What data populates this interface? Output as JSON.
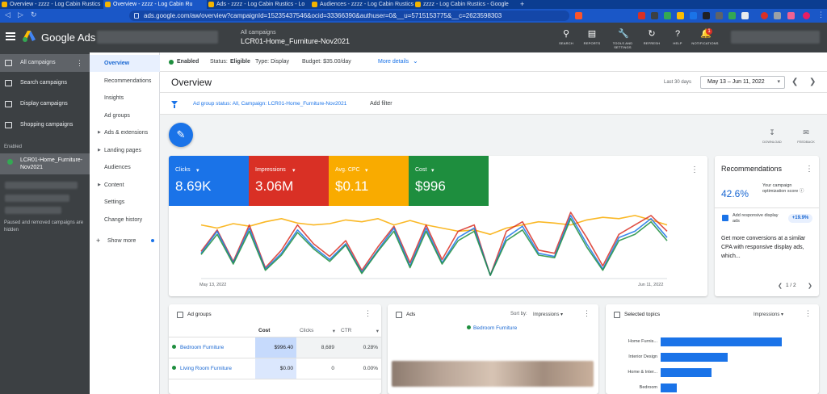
{
  "browser": {
    "tabs": [
      {
        "label": "Overview - zzzz - Log Cabin Rustics"
      },
      {
        "label": "Overview - zzzz - Log Cabin Ru"
      },
      {
        "label": "Ads - zzzz - Log Cabin Rustics - Lo"
      },
      {
        "label": "Audiences - zzzz - Log Cabin Rustics"
      },
      {
        "label": "zzzz - Log Cabin Rustics - Google"
      }
    ],
    "url": "ads.google.com/aw/overview?campaignId=15235437546&ocid=33366390&authuser=0&__u=5715153775&__c=2623598303"
  },
  "header": {
    "product": "Google Ads",
    "crumb": "All campaigns",
    "campaign": "LCR01-Home_Furniture-Nov2021",
    "tools": [
      {
        "label": "SEARCH",
        "icon": "search-icon"
      },
      {
        "label": "REPORTS",
        "icon": "reports-icon"
      },
      {
        "label": "TOOLS AND SETTINGS",
        "icon": "wrench-icon"
      },
      {
        "label": "REFRESH",
        "icon": "refresh-icon"
      },
      {
        "label": "HELP",
        "icon": "help-icon"
      },
      {
        "label": "NOTIFICATIONS",
        "icon": "bell-icon"
      }
    ],
    "notification_count": "1"
  },
  "leftnav": {
    "items": [
      {
        "label": "All campaigns"
      },
      {
        "label": "Search campaigns"
      },
      {
        "label": "Display campaigns"
      },
      {
        "label": "Shopping campaigns"
      }
    ],
    "enabled_heading": "Enabled",
    "campaign": "LCR01-Home_Furniture-Nov2021",
    "note": "Paused and removed campaigns are hidden"
  },
  "pagemenu": {
    "items": [
      {
        "label": "Overview"
      },
      {
        "label": "Recommendations"
      },
      {
        "label": "Insights"
      },
      {
        "label": "Ad groups"
      },
      {
        "label": "Ads & extensions"
      },
      {
        "label": "Landing pages"
      },
      {
        "label": "Audiences"
      },
      {
        "label": "Content"
      },
      {
        "label": "Settings"
      },
      {
        "label": "Change history"
      }
    ],
    "show_more": "Show more"
  },
  "status": {
    "state": "Enabled",
    "status_label": "Status:",
    "status_value": "Eligible",
    "type": "Type: Display",
    "budget": "Budget: $35.00/day",
    "more": "More details"
  },
  "title_row": {
    "title": "Overview",
    "range_label": "Last 30 days",
    "date_range": "May 13 – Jun 11, 2022"
  },
  "filter": {
    "text": "Ad group status: All, Campaign: LCR01-Home_Furniture-Nov2021",
    "add": "Add filter"
  },
  "tiny_tools": {
    "download": "DOWNLOAD",
    "feedback": "FEEDBACK"
  },
  "metrics": [
    {
      "label": "Clicks",
      "value": "8.69K",
      "color": "#1a73e8"
    },
    {
      "label": "Impressions",
      "value": "3.06M",
      "color": "#d93025"
    },
    {
      "label": "Avg. CPC",
      "value": "$0.11",
      "color": "#f9ab00"
    },
    {
      "label": "Cost",
      "value": "$996",
      "color": "#1e8e3e"
    }
  ],
  "chart_data": {
    "type": "line",
    "x_start": "May 13, 2022",
    "x_end": "Jun 11, 2022",
    "series": [
      {
        "name": "Clicks",
        "color": "#1a73e8",
        "values": [
          0.35,
          0.7,
          0.2,
          0.75,
          0.1,
          0.35,
          0.72,
          0.45,
          0.25,
          0.5,
          0.05,
          0.4,
          0.75,
          0.15,
          0.75,
          0.2,
          0.6,
          0.75,
          0.0,
          0.6,
          0.78,
          0.35,
          0.3,
          0.95,
          0.5,
          0.1,
          0.6,
          0.7,
          0.9,
          0.6
        ]
      },
      {
        "name": "Impressions",
        "color": "#d93025",
        "values": [
          0.38,
          0.72,
          0.22,
          0.8,
          0.12,
          0.4,
          0.8,
          0.5,
          0.3,
          0.55,
          0.08,
          0.45,
          0.78,
          0.2,
          0.8,
          0.25,
          0.7,
          0.8,
          0.0,
          0.7,
          0.85,
          0.4,
          0.35,
          1.0,
          0.6,
          0.15,
          0.65,
          0.8,
          0.95,
          0.7
        ]
      },
      {
        "name": "Avg. CPC",
        "color": "#f9ab00",
        "values": [
          0.8,
          0.75,
          0.82,
          0.78,
          0.85,
          0.9,
          0.83,
          0.8,
          0.82,
          0.88,
          0.85,
          0.9,
          0.8,
          0.87,
          0.8,
          0.75,
          0.7,
          0.72,
          0.65,
          0.75,
          0.8,
          0.85,
          0.83,
          0.8,
          0.88,
          0.92,
          0.9,
          0.95,
          0.88,
          0.8
        ]
      },
      {
        "name": "Cost",
        "color": "#1e8e3e",
        "values": [
          0.33,
          0.65,
          0.18,
          0.7,
          0.08,
          0.32,
          0.68,
          0.42,
          0.22,
          0.48,
          0.03,
          0.38,
          0.7,
          0.12,
          0.7,
          0.18,
          0.55,
          0.7,
          0.0,
          0.55,
          0.72,
          0.32,
          0.28,
          0.9,
          0.45,
          0.08,
          0.55,
          0.65,
          0.85,
          0.55
        ]
      }
    ]
  },
  "recommendations": {
    "title": "Recommendations",
    "score": "42.6%",
    "score_label": "Your campaign optimization score",
    "item": "Add responsive display ads",
    "uplift": "+19.9%",
    "body": "Get more conversions at a similar CPA with responsive display ads, which...",
    "pager": "1 / 2"
  },
  "ad_groups": {
    "title": "Ad groups",
    "columns": [
      "Cost",
      "Clicks",
      "CTR"
    ],
    "rows": [
      {
        "name": "Bedroom Furniture",
        "cost": "$996.40",
        "clicks": "8,689",
        "ctr": "0.28%"
      },
      {
        "name": "Living Room Furniture",
        "cost": "$0.00",
        "clicks": "0",
        "ctr": "0.00%"
      }
    ]
  },
  "ads": {
    "title": "Ads",
    "sort_label": "Sort by:",
    "sort_value": "Impressions",
    "ad_group": "Bedroom Furniture"
  },
  "topics": {
    "title": "Selected topics",
    "sort_value": "Impressions",
    "bars": [
      {
        "label": "Home Furnis...",
        "value": 1.0
      },
      {
        "label": "Interior Design",
        "value": 0.55
      },
      {
        "label": "Home & Inter...",
        "value": 0.42
      },
      {
        "label": "Bedroom",
        "value": 0.13
      }
    ]
  }
}
